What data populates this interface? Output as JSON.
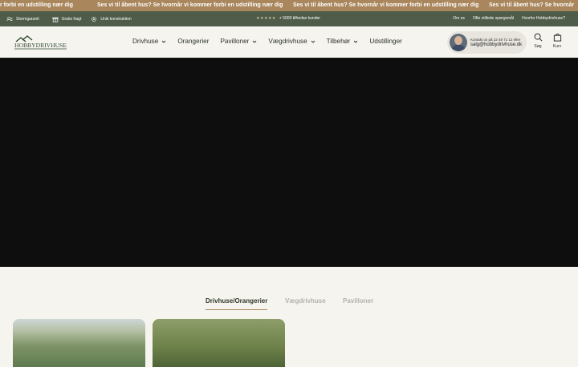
{
  "announcement": {
    "segments": [
      "r forbi en udstilling nær dig",
      "Ses vi til åbent hus? Se hvornår vi kommer forbi en udstilling nær dig",
      "Ses vi til åbent hus? Se hvornår vi kommer forbi en udstilling nær dig",
      "Ses vi til åbent hus? Se hvornår"
    ]
  },
  "utility_bar": {
    "usps": [
      {
        "icon": "storm-icon",
        "label": "Stormgaranti"
      },
      {
        "icon": "gift-icon",
        "label": "Gratis fragt"
      },
      {
        "icon": "gear-icon",
        "label": "Unik konstruktion"
      }
    ],
    "rating_stars": "★★★★★",
    "customers": "+ 5000 tilfredse kunder",
    "links": [
      "Om os",
      "Ofte stillede spørgsmål",
      "Hvorfor Hobbydrivhuse?"
    ]
  },
  "header": {
    "logo_text": "HOBBYDRIVHUSE",
    "nav": [
      {
        "label": "Drivhuse",
        "dropdown": true
      },
      {
        "label": "Orangerier",
        "dropdown": false
      },
      {
        "label": "Pavilloner",
        "dropdown": true
      },
      {
        "label": "Vægdrivhuse",
        "dropdown": true
      },
      {
        "label": "Tilbehør",
        "dropdown": true
      },
      {
        "label": "Udstillinger",
        "dropdown": false
      }
    ],
    "contact": {
      "line1": "Kontakt os på 22 48 71 12 eller",
      "line2": "salg@hobbydrivhuse.dk"
    },
    "search_label": "Søg",
    "cart_label": "Kurv"
  },
  "category_tabs": [
    {
      "label": "Drivhuse/Orangerier",
      "active": true
    },
    {
      "label": "Vægdrivhuse",
      "active": false
    },
    {
      "label": "Pavilloner",
      "active": false
    }
  ],
  "colors": {
    "announcement_bg": "#a9865c",
    "utility_bg": "#4f5c4a",
    "page_bg": "#f6f4ef",
    "hero_bg": "#0e0e0e",
    "brand_green": "#2f4a33"
  }
}
